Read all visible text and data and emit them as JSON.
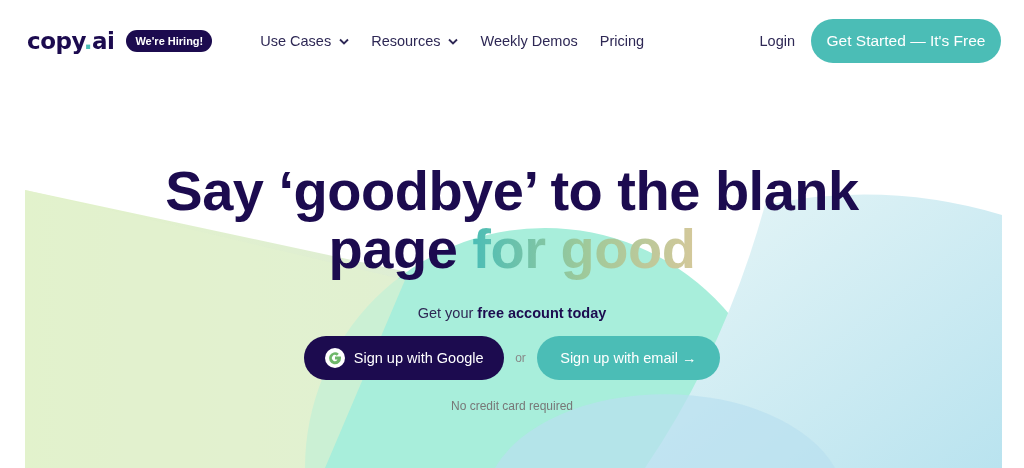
{
  "header": {
    "logo": [
      "copy",
      ".",
      "ai"
    ],
    "badge": "We're Hiring!",
    "nav": [
      {
        "label": "Use Cases",
        "dropdown": true
      },
      {
        "label": "Resources",
        "dropdown": true
      },
      {
        "label": "Weekly Demos",
        "dropdown": false
      },
      {
        "label": "Pricing",
        "dropdown": false
      }
    ],
    "login": "Login",
    "cta": "Get Started — It's Free"
  },
  "hero": {
    "headline": "Say ‘goodbye’ to the blank page",
    "headline_highlight": "for good",
    "subtitle": "Get your **free account today**",
    "google_button": "Sign up with Google",
    "separator": "or",
    "email_button": "Sign up with email →",
    "note": "No credit card required"
  }
}
